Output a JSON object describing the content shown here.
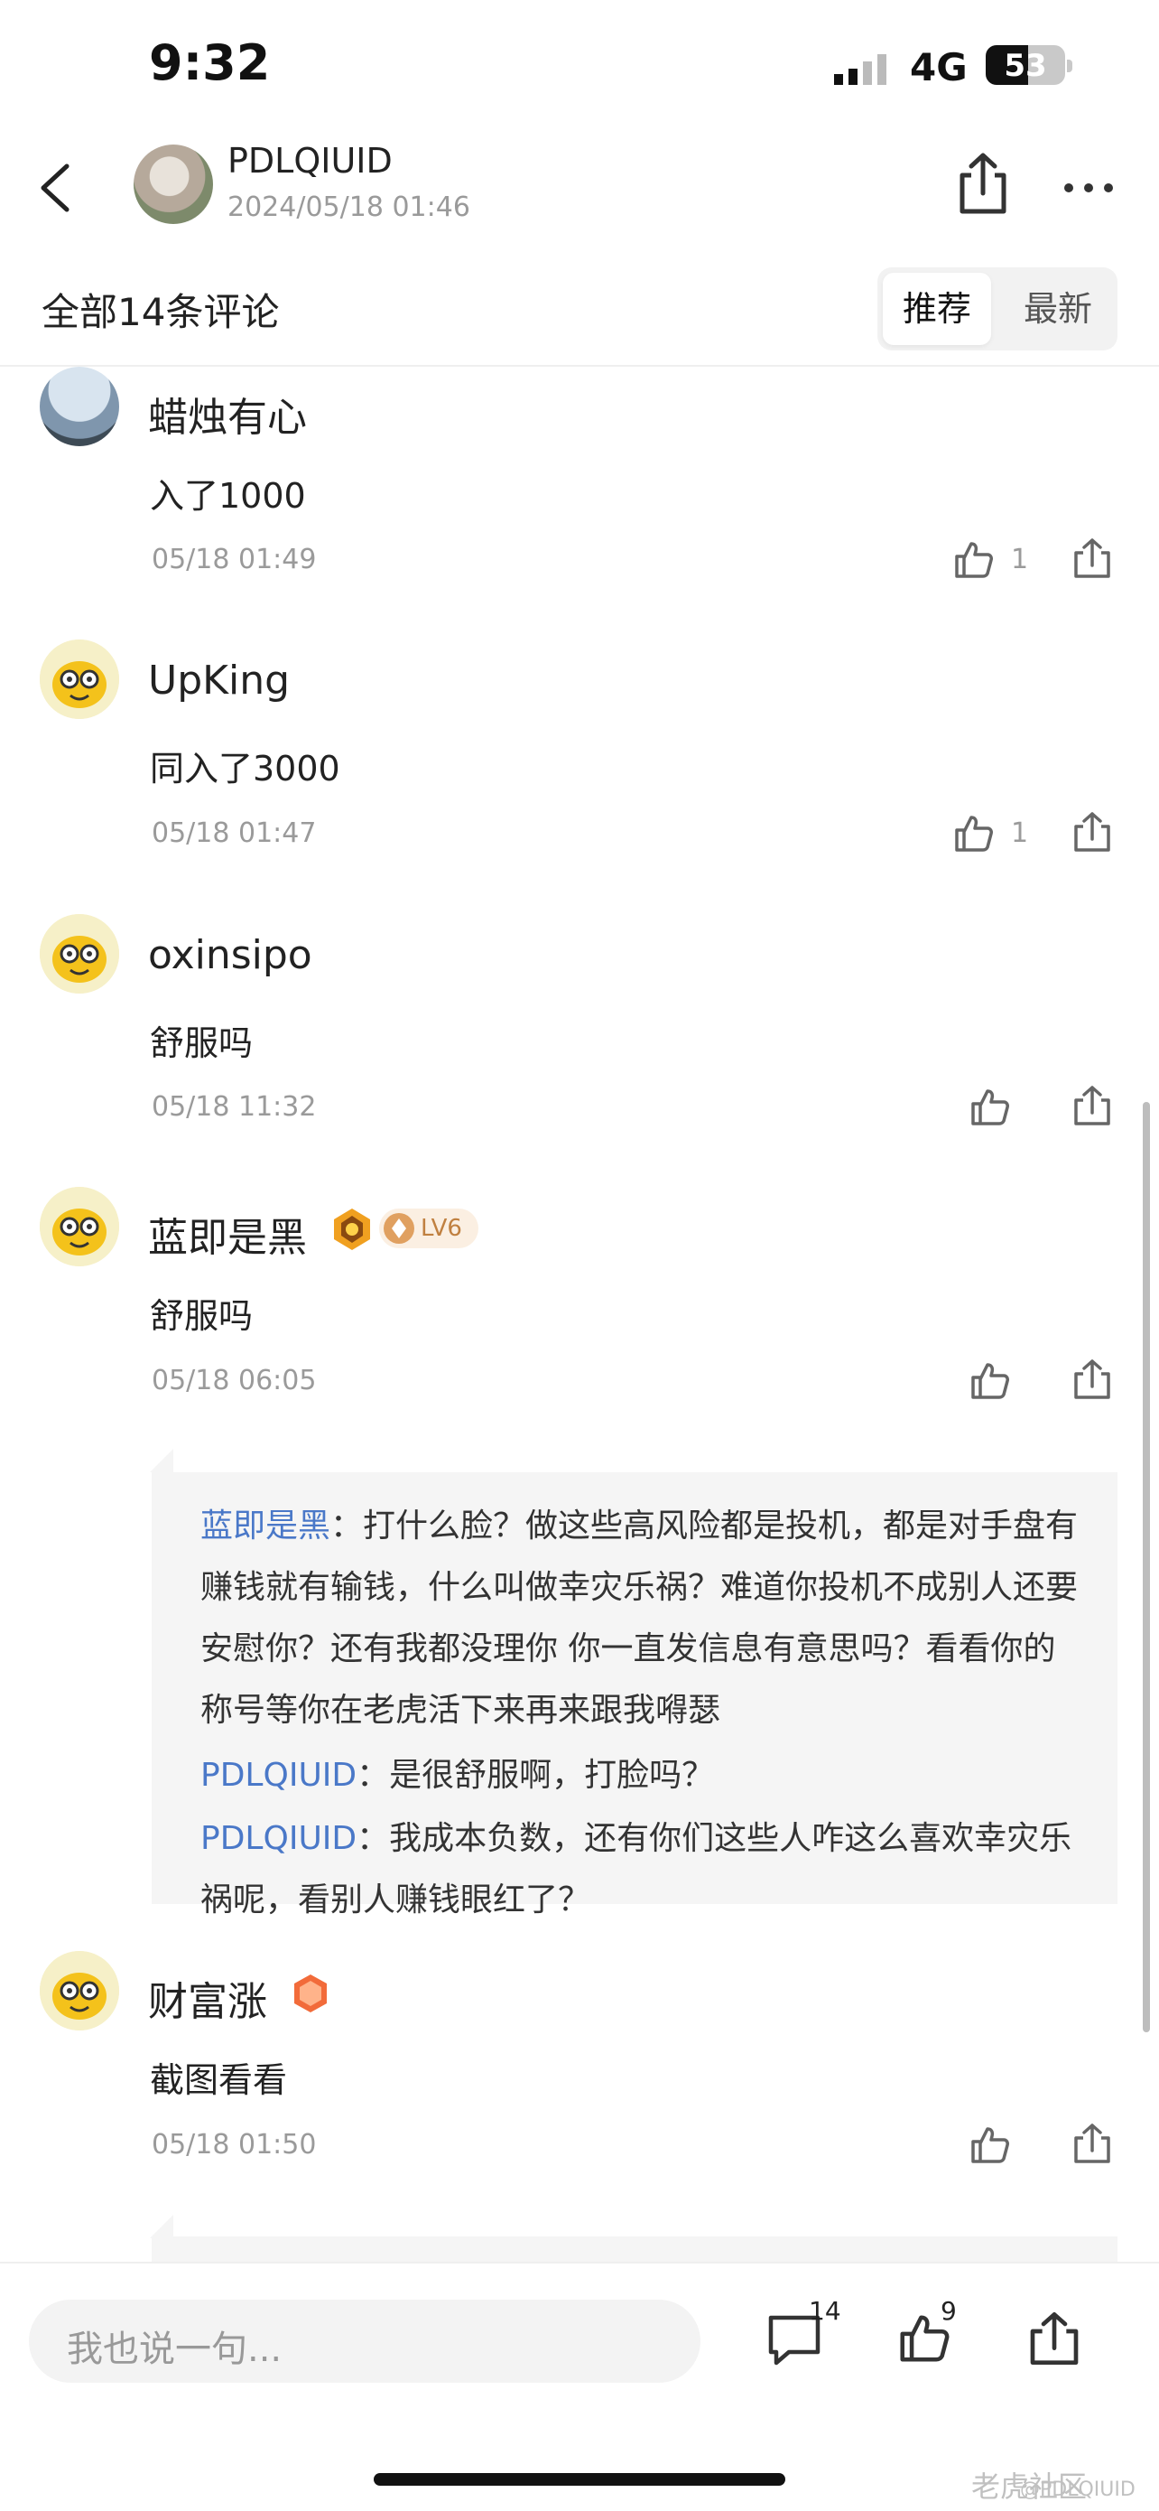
{
  "status": {
    "time": "9:32",
    "network": "4G",
    "battery": "53",
    "battery_level": 0.53
  },
  "header": {
    "author": "PDLQIUID",
    "datetime": "2024/05/18 01:46"
  },
  "tabs": {
    "title": "全部14条评论",
    "recommended": "推荐",
    "latest": "最新"
  },
  "comments": [
    {
      "name": "蜡烛有心",
      "text": "入了1000",
      "time": "05/18 01:49",
      "likes": "1",
      "avatar": "landmark-photo"
    },
    {
      "name": "UpKing",
      "text": "同入了3000",
      "time": "05/18 01:47",
      "likes": "1",
      "avatar": "tiger-mascot"
    },
    {
      "name": "oxinsipo",
      "text": "舒服吗",
      "time": "05/18 11:32",
      "likes": "",
      "avatar": "tiger-mascot"
    },
    {
      "name": "蓝即是黑",
      "text": "舒服吗",
      "time": "05/18 06:05",
      "likes": "",
      "avatar": "tiger-mascot",
      "level": "LV6"
    },
    {
      "name": "财富涨",
      "text": "截图看看",
      "time": "05/18 01:50",
      "likes": "",
      "avatar": "tiger-mascot"
    }
  ],
  "replies": [
    {
      "name": "蓝即是黑",
      "sep": "：",
      "lines": [
        "打什么脸？做这些高风险都是投机，都是对手盘有",
        "赚钱就有输钱，什么叫做幸灾乐祸？难道你投机不成别人还要",
        "安慰你？还有我都没理你 你一直发信息有意思吗？看看你的",
        "称号等你在老虎活下来再来跟我嘚瑟"
      ]
    },
    {
      "name": "PDLQIUID",
      "sep": "：",
      "lines": [
        "是很舒服啊，打脸吗？"
      ]
    },
    {
      "name": "PDLQIUID",
      "sep": "：",
      "lines": [
        "我成本负数，还有你们这些人咋这么喜欢幸灾乐",
        "祸呢，看别人赚钱眼红了？"
      ]
    }
  ],
  "bottom": {
    "placeholder": "我也说一句...",
    "comment_count": "14",
    "like_count": "9"
  },
  "watermark": {
    "brand": "老虎社区",
    "handle": "@PDLQIUID"
  },
  "colors": {
    "reply_name": "#4a78c8",
    "meta": "#9a9a9a",
    "reply_bg": "#f5f5f5"
  }
}
